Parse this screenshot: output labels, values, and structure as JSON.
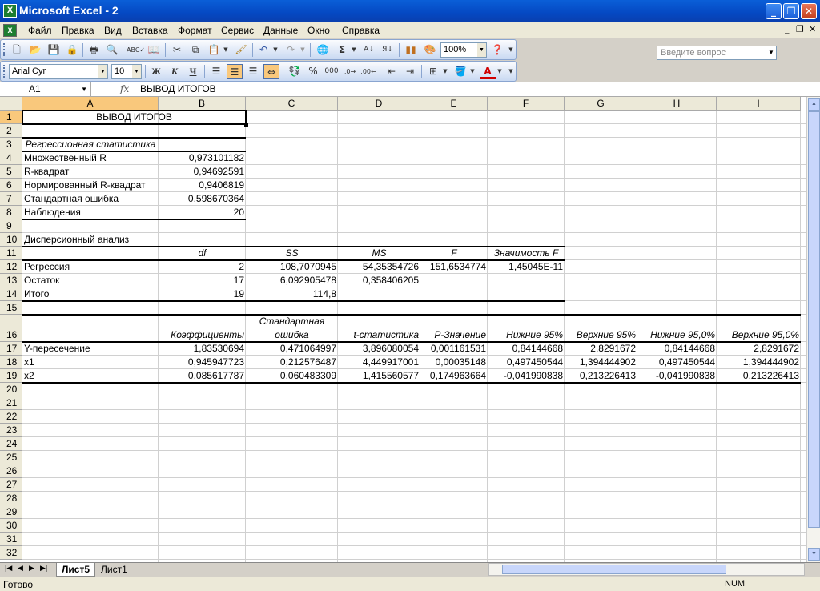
{
  "window": {
    "title": "Microsoft Excel - 2"
  },
  "menu": [
    "Файл",
    "Правка",
    "Вид",
    "Вставка",
    "Формат",
    "Сервис",
    "Данные",
    "Окно",
    "Справка"
  ],
  "help_placeholder": "Введите вопрос",
  "toolbar": {
    "zoom": "100%",
    "font": "Arial Cyr",
    "size": "10"
  },
  "formula": {
    "name_box": "A1",
    "fx": "fx",
    "content": "ВЫВОД ИТОГОВ"
  },
  "columns": [
    "A",
    "B",
    "C",
    "D",
    "E",
    "F",
    "G",
    "H",
    "I"
  ],
  "rows": [
    "1",
    "2",
    "3",
    "4",
    "5",
    "6",
    "7",
    "8",
    "9",
    "10",
    "11",
    "12",
    "13",
    "14",
    "15",
    "16",
    "17",
    "18",
    "19",
    "20",
    "21",
    "22",
    "23",
    "24",
    "25",
    "26",
    "27",
    "28",
    "29",
    "30",
    "31",
    "32"
  ],
  "cells": {
    "a1": "ВЫВОД ИТОГОВ",
    "a3": "Регрессионная статистика",
    "a4": "Множественный R",
    "b4": "0,973101182",
    "a5": "R-квадрат",
    "b5": "0,94692591",
    "a6": "Нормированный R-квадрат",
    "b6": "0,9406819",
    "a7": "Стандартная ошибка",
    "b7": "0,598670364",
    "a8": "Наблюдения",
    "b8": "20",
    "a10": "Дисперсионный анализ",
    "b11": "df",
    "c11": "SS",
    "d11": "MS",
    "e11": "F",
    "f11": "Значимость F",
    "a12": "Регрессия",
    "b12": "2",
    "c12": "108,7070945",
    "d12": "54,35354726",
    "e12": "151,6534774",
    "f12": "1,45045E-11",
    "a13": "Остаток",
    "b13": "17",
    "c13": "6,092905478",
    "d13": "0,358406205",
    "a14": "Итого",
    "b14": "19",
    "c14": "114,8",
    "b16": "Коэффициенты",
    "c16a": "Стандартная",
    "c16b": "ошибка",
    "d16": "t-статистика",
    "e16": "P-Значение",
    "f16": "Нижние 95%",
    "g16": "Верхние 95%",
    "h16": "Нижние 95,0%",
    "i16": "Верхние 95,0%",
    "a17": "Y-пересечение",
    "b17": "1,83530694",
    "c17": "0,471064997",
    "d17": "3,896080054",
    "e17": "0,001161531",
    "f17": "0,84144668",
    "g17": "2,8291672",
    "h17": "0,84144668",
    "i17": "2,8291672",
    "a18": "x1",
    "b18": "0,945947723",
    "c18": "0,212576487",
    "d18": "4,449917001",
    "e18": "0,00035148",
    "f18": "0,497450544",
    "g18": "1,394444902",
    "h18": "0,497450544",
    "i18": "1,394444902",
    "a19": "x2",
    "b19": "0,085617787",
    "c19": "0,060483309",
    "d19": "1,415560577",
    "e19": "0,174963664",
    "f19": "-0,041990838",
    "g19": "0,213226413",
    "h19": "-0,041990838",
    "i19": "0,213226413"
  },
  "sheets": [
    "Лист5",
    "Лист1"
  ],
  "status": {
    "ready": "Готово",
    "num": "NUM"
  }
}
